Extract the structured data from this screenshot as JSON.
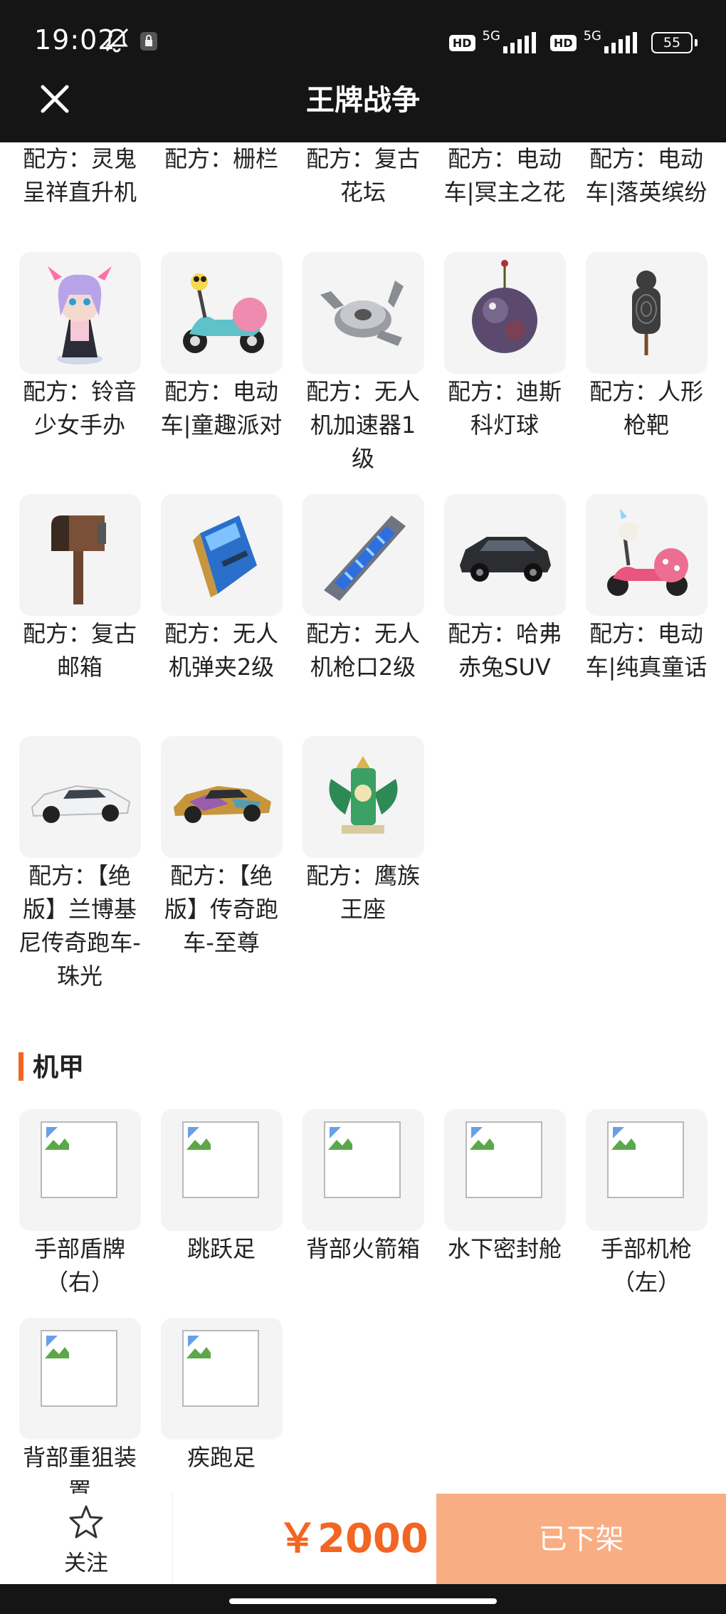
{
  "status_bar": {
    "time": "19:02",
    "network_1": "5G",
    "network_2": "5G",
    "hd_label": "HD",
    "battery": "55"
  },
  "header": {
    "title": "王牌战争",
    "close_icon": "close-icon"
  },
  "top_row_partial": [
    {
      "name": "配方：灵鬼呈祥直升机"
    },
    {
      "name": "配方：栅栏"
    },
    {
      "name": "配方：复古花坛"
    },
    {
      "name": "配方：电动车|冥主之花"
    },
    {
      "name": "配方：电动车|落英缤纷"
    }
  ],
  "blueprints": [
    {
      "name": "配方：铃音少女手办",
      "icon": "figure-icon"
    },
    {
      "name": "配方：电动车|童趣派对",
      "icon": "scooter-icon"
    },
    {
      "name": "配方：无人机加速器1级",
      "icon": "drone-part-icon"
    },
    {
      "name": "配方：迪斯科灯球",
      "icon": "disco-ball-icon"
    },
    {
      "name": "配方：人形枪靶",
      "icon": "target-icon"
    },
    {
      "name": "配方：复古邮箱",
      "icon": "mailbox-icon"
    },
    {
      "name": "配方：无人机弹夹2级",
      "icon": "magazine-icon"
    },
    {
      "name": "配方：无人机枪口2级",
      "icon": "muzzle-icon"
    },
    {
      "name": "配方：哈弗赤兔SUV",
      "icon": "suv-icon"
    },
    {
      "name": "配方：电动车|纯真童话",
      "icon": "scooter-icon"
    },
    {
      "name": "配方：【绝版】兰博基尼传奇跑车-珠光",
      "icon": "sportscar-icon"
    },
    {
      "name": "配方：【绝版】传奇跑车-至尊",
      "icon": "sportscar-icon"
    },
    {
      "name": "配方：鹰族王座",
      "icon": "throne-icon"
    }
  ],
  "mech_section": {
    "title": "机甲",
    "items": [
      {
        "name": "手部盾牌（右）"
      },
      {
        "name": "跳跃足"
      },
      {
        "name": "背部火箭箱"
      },
      {
        "name": "水下密封舱"
      },
      {
        "name": "手部机枪（左）"
      },
      {
        "name": "背部重狙装置"
      },
      {
        "name": "疾跑足"
      }
    ]
  },
  "bottom_bar": {
    "follow_label": "关注",
    "price": "￥2000",
    "status_button": "已下架"
  },
  "colors": {
    "accent": "#f26522",
    "disabled_button": "#f9ad82",
    "bar": "#151515"
  }
}
